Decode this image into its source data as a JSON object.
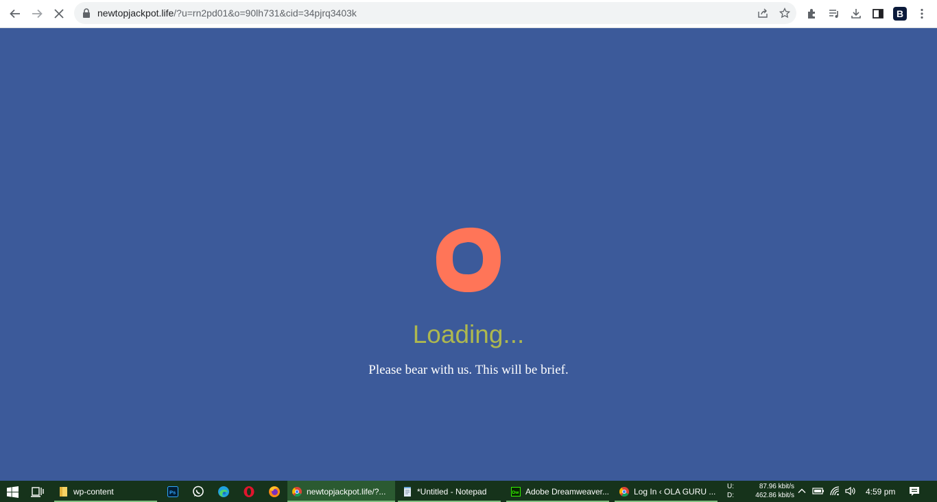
{
  "browser": {
    "url_host": "newtopjackpot.life",
    "url_path": "/?u=rn2pd01&o=90lh731&cid=34pjrq3403k",
    "profile_initial": "B"
  },
  "page": {
    "loading_title": "Loading...",
    "loading_subtitle": "Please bear with us. This will be brief.",
    "colors": {
      "background": "#3c5a9a",
      "logo": "#ff7558",
      "title": "#aeb84f",
      "subtitle": "#ffffff"
    }
  },
  "taskbar": {
    "apps": [
      {
        "label": "wp-content"
      },
      {
        "label": "newtopjackpot.life/?..."
      },
      {
        "label": "*Untitled - Notepad"
      },
      {
        "label": "Adobe Dreamweaver..."
      },
      {
        "label": "Log In ‹ OLA GURU ..."
      }
    ],
    "network": {
      "upload_label": "U:",
      "upload_value": "87.96 kbit/s",
      "download_label": "D:",
      "download_value": "462.86 kbit/s"
    },
    "clock": "4:59 pm"
  }
}
